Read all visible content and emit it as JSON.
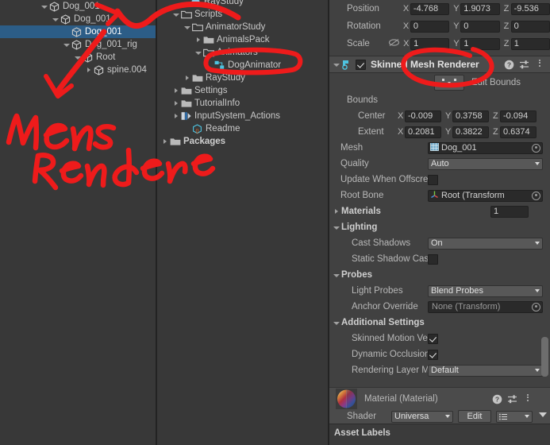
{
  "hierarchy": {
    "rows": [
      {
        "label": "Dog_001",
        "indent": 50,
        "arrow": "open",
        "icon": "gameobject-cube-icon",
        "selected": false,
        "bold": false
      },
      {
        "label": "Dog_001",
        "indent": 64,
        "arrow": "open",
        "icon": "gameobject-cube-icon",
        "selected": false,
        "bold": false
      },
      {
        "label": "Dog_001",
        "indent": 78,
        "arrow": "none",
        "icon": "gameobject-cube-icon",
        "selected": true,
        "bold": false
      },
      {
        "label": "Dog_001_rig",
        "indent": 78,
        "arrow": "open",
        "icon": "gameobject-cube-icon",
        "selected": false,
        "bold": false
      },
      {
        "label": "Root",
        "indent": 92,
        "arrow": "open",
        "icon": "gameobject-cube-icon",
        "selected": false,
        "bold": false
      },
      {
        "label": "spine.004",
        "indent": 106,
        "arrow": "closed",
        "icon": "gameobject-cube-icon",
        "selected": false,
        "bold": false
      }
    ]
  },
  "project": {
    "rows": [
      {
        "label": "RayStudy",
        "indent": 30,
        "arrow": "none",
        "icon": "prefab-icon",
        "bold": false,
        "clipped": true
      },
      {
        "label": "Scripts",
        "indent": 18,
        "arrow": "open",
        "icon": "folder-open-icon",
        "bold": false
      },
      {
        "label": "AnimatorStudy",
        "indent": 32,
        "arrow": "open",
        "icon": "folder-open-icon",
        "bold": false
      },
      {
        "label": "AnimalsPack",
        "indent": 46,
        "arrow": "closed",
        "icon": "folder-icon",
        "bold": false
      },
      {
        "label": "Animators",
        "indent": 46,
        "arrow": "open",
        "icon": "folder-open-icon",
        "bold": false
      },
      {
        "label": "DogAnimator",
        "indent": 60,
        "arrow": "none",
        "icon": "animator-controller-icon",
        "bold": false
      },
      {
        "label": "RayStudy",
        "indent": 32,
        "arrow": "closed",
        "icon": "folder-icon",
        "bold": false
      },
      {
        "label": "Settings",
        "indent": 18,
        "arrow": "closed",
        "icon": "folder-icon",
        "bold": false
      },
      {
        "label": "TutorialInfo",
        "indent": 18,
        "arrow": "closed",
        "icon": "folder-icon",
        "bold": false
      },
      {
        "label": "InputSystem_Actions",
        "indent": 18,
        "arrow": "closed",
        "icon": "input-actions-icon",
        "bold": false
      },
      {
        "label": "Readme",
        "indent": 32,
        "arrow": "none",
        "icon": "readme-script-icon",
        "bold": false
      },
      {
        "label": "Packages",
        "indent": 4,
        "arrow": "closed",
        "icon": "folder-icon",
        "bold": true
      }
    ]
  },
  "inspector": {
    "transform": {
      "position": {
        "label": "Position",
        "x": "-4.768",
        "y": "1.9073",
        "z": "-9.536"
      },
      "rotation": {
        "label": "Rotation",
        "x": "0",
        "y": "0",
        "z": "0"
      },
      "scale": {
        "label": "Scale",
        "x": "1",
        "y": "1",
        "z": "1"
      }
    },
    "component": {
      "title": "Skinned Mesh Renderer",
      "enabled": true,
      "edit_bounds_label": "Edit Bounds"
    },
    "bounds": {
      "title": "Bounds",
      "center": {
        "label": "Center",
        "x": "-0.009",
        "y": "0.3758",
        "z": "-0.094"
      },
      "extent": {
        "label": "Extent",
        "x": "0.2081",
        "y": "0.3822",
        "z": "0.6374"
      }
    },
    "mesh": {
      "label": "Mesh",
      "value": "Dog_001"
    },
    "quality": {
      "label": "Quality",
      "value": "Auto"
    },
    "offscreen": {
      "label": "Update When Offscre",
      "checked": false
    },
    "root_bone": {
      "label": "Root Bone",
      "value": "Root (Transform"
    },
    "materials": {
      "label": "Materials",
      "count": "1"
    },
    "lighting": {
      "title": "Lighting",
      "cast_shadows": {
        "label": "Cast Shadows",
        "value": "On"
      },
      "static_shadow": {
        "label": "Static Shadow Cas",
        "checked": false
      }
    },
    "probes": {
      "title": "Probes",
      "light_probes": {
        "label": "Light Probes",
        "value": "Blend Probes"
      },
      "anchor_override": {
        "label": "Anchor Override",
        "value": "None (Transform)"
      }
    },
    "additional": {
      "title": "Additional Settings",
      "skinned_motion": {
        "label": "Skinned Motion Ve",
        "checked": true
      },
      "dynamic_occlusion": {
        "label": "Dynamic Occlusion",
        "checked": true
      },
      "rendering_layer": {
        "label": "Rendering Layer M",
        "value": "Default"
      }
    },
    "material": {
      "title": "Material (Material)",
      "shader_label": "Shader",
      "shader_value": "Universa",
      "edit_label": "Edit"
    }
  },
  "footer": {
    "asset_labels": "Asset Labels"
  },
  "annotations": {
    "handwritten_line1": "Mesh",
    "handwritten_line2": "Renderer",
    "color": "#ee1b1b"
  }
}
